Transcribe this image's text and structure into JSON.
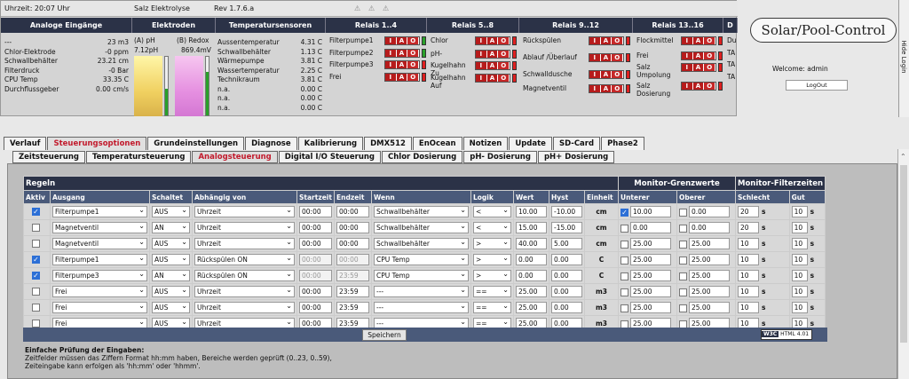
{
  "status": {
    "time": "Uhrzeit: 20:07 Uhr",
    "device": "Salz Elektrolyse",
    "rev": "Rev 1.7.6.a"
  },
  "sections": {
    "analog": "Analoge Eingänge",
    "elektroden": "Elektroden",
    "temp": "Temperatursensoren",
    "r1": "Relais 1..4",
    "r2": "Relais 5..8",
    "r3": "Relais 9..12",
    "r4": "Relais 13..16",
    "r5": "D"
  },
  "analog": [
    {
      "k": "---",
      "v": "23 m3"
    },
    {
      "k": "Chlor-Elektrode",
      "v": "-0 ppm"
    },
    {
      "k": "Schwallbehälter",
      "v": "23.21 cm"
    },
    {
      "k": "Filterdruck",
      "v": "-0 Bar"
    },
    {
      "k": "CPU Temp",
      "v": "33.35 C"
    },
    {
      "k": "Durchflussgeber",
      "v": "0.00 cm/s"
    }
  ],
  "elektroden": {
    "ph_label": "(A) pH",
    "ph_value": "7.12pH",
    "redox_label": "(B) Redox",
    "redox_value": "869.4mV",
    "ph_level": 0.45,
    "redox_level": 0.75
  },
  "temps": [
    {
      "k": "Aussentemperatur",
      "v": "4.31 C"
    },
    {
      "k": "Schwallbehälter",
      "v": "1.13 C"
    },
    {
      "k": "Wärmepumpe",
      "v": "3.81 C"
    },
    {
      "k": "Wassertemperatur",
      "v": "2.25 C"
    },
    {
      "k": "Technikraum",
      "v": "3.81 C"
    },
    {
      "k": "n.a.",
      "v": "0.00 C"
    },
    {
      "k": "n.a.",
      "v": "0.00 C"
    },
    {
      "k": "n.a.",
      "v": "0.00 C"
    }
  ],
  "relais1": [
    "Filterpumpe1",
    "Filterpumpe2",
    "Filterpumpe3",
    "Frei"
  ],
  "relais2": [
    "Chlor",
    "pH-",
    "Kugelhahn Zu",
    "Kugelhahn Auf"
  ],
  "relais3": [
    "Rückspülen",
    "Ablauf /Überlauf",
    "Schwalldusche",
    "Magnetventil"
  ],
  "relais4": [
    "Flockmittel",
    "Frei",
    "Salz Umpolung",
    "Salz Dosierung"
  ],
  "relais5": [
    "Du",
    "TA",
    "TA",
    "TA"
  ],
  "iao": {
    "i": "I",
    "a": "A",
    "o": "O"
  },
  "logo": "Solar/Pool-Control",
  "welcome": "Welcome:  admin",
  "logout": "LogOut",
  "hidelogin": "Hide Login",
  "tabs": [
    "Verlauf",
    "Steuerungsoptionen",
    "Grundeinstellungen",
    "Diagnose",
    "Kalibrierung",
    "DMX512",
    "EnOcean",
    "Notizen",
    "Update",
    "SD-Card",
    "Phase2"
  ],
  "subtabs": [
    "Zeitsteuerung",
    "Temperatursteuerung",
    "Analogsteuerung",
    "Digital I/O Steuerung",
    "Chlor Dosierung",
    "pH- Dosierung",
    "pH+ Dosierung"
  ],
  "grid": {
    "title": "Regeln",
    "monitor": "Monitor-Grenzwerte",
    "filterzeit": "Monitor-Filterzeiten",
    "cols": [
      "Aktiv",
      "Ausgang",
      "Schaltet",
      "Abhängig von",
      "Startzeit",
      "Endzeit",
      "Wenn",
      "Logik",
      "Wert",
      "Hyst",
      "Einheit",
      "Unterer",
      "Oberer",
      "Schlecht",
      "Gut"
    ],
    "rows": [
      {
        "aktiv": true,
        "ausgang": "Filterpumpe1",
        "schaltet": "AUS",
        "abh": "Uhrzeit",
        "start": "00:00",
        "end": "00:00",
        "wenn": "Schwallbehälter",
        "logik": "<",
        "wert": "10.00",
        "hyst": "-10.00",
        "einheit": "cm",
        "uc": true,
        "u": "10.00",
        "oc": false,
        "o": "0.00",
        "s": "20",
        "g": "10"
      },
      {
        "aktiv": false,
        "ausgang": "Magnetventil",
        "schaltet": "AN",
        "abh": "Uhrzeit",
        "start": "00:00",
        "end": "00:00",
        "wenn": "Schwallbehälter",
        "logik": "<",
        "wert": "15.00",
        "hyst": "-15.00",
        "einheit": "cm",
        "uc": false,
        "u": "0.00",
        "oc": false,
        "o": "0.00",
        "s": "20",
        "g": "10"
      },
      {
        "aktiv": false,
        "ausgang": "Magnetventil",
        "schaltet": "AUS",
        "abh": "Uhrzeit",
        "start": "00:00",
        "end": "00:00",
        "wenn": "Schwallbehälter",
        "logik": ">",
        "wert": "40.00",
        "hyst": "5.00",
        "einheit": "cm",
        "uc": false,
        "u": "25.00",
        "oc": false,
        "o": "25.00",
        "s": "10",
        "g": "10"
      },
      {
        "aktiv": true,
        "ausgang": "Filterpumpe1",
        "schaltet": "AUS",
        "abh": "Rückspülen ON",
        "start": "00:00",
        "end": "00:00",
        "wenn": "CPU Temp",
        "logik": ">",
        "wert": "0.00",
        "hyst": "0.00",
        "einheit": "C",
        "uc": false,
        "u": "25.00",
        "oc": false,
        "o": "25.00",
        "s": "10",
        "g": "10"
      },
      {
        "aktiv": true,
        "ausgang": "Filterpumpe3",
        "schaltet": "AN",
        "abh": "Rückspülen ON",
        "start": "00:00",
        "end": "23:59",
        "wenn": "CPU Temp",
        "logik": ">",
        "wert": "0.00",
        "hyst": "0.00",
        "einheit": "C",
        "uc": false,
        "u": "25.00",
        "oc": false,
        "o": "25.00",
        "s": "10",
        "g": "10"
      },
      {
        "aktiv": false,
        "ausgang": "Frei",
        "schaltet": "AUS",
        "abh": "Uhrzeit",
        "start": "00:00",
        "end": "23:59",
        "wenn": "---",
        "logik": "==",
        "wert": "25.00",
        "hyst": "0.00",
        "einheit": "m3",
        "uc": false,
        "u": "25.00",
        "oc": false,
        "o": "25.00",
        "s": "10",
        "g": "10"
      },
      {
        "aktiv": false,
        "ausgang": "Frei",
        "schaltet": "AUS",
        "abh": "Uhrzeit",
        "start": "00:00",
        "end": "23:59",
        "wenn": "---",
        "logik": "==",
        "wert": "25.00",
        "hyst": "0.00",
        "einheit": "m3",
        "uc": false,
        "u": "25.00",
        "oc": false,
        "o": "25.00",
        "s": "10",
        "g": "10"
      },
      {
        "aktiv": false,
        "ausgang": "Frei",
        "schaltet": "AUS",
        "abh": "Uhrzeit",
        "start": "00:00",
        "end": "23:59",
        "wenn": "---",
        "logik": "==",
        "wert": "25.00",
        "hyst": "0.00",
        "einheit": "m3",
        "uc": false,
        "u": "25.00",
        "oc": false,
        "o": "25.00",
        "s": "10",
        "g": "10"
      }
    ],
    "sec": "s"
  },
  "save": "Speichern",
  "valid": "HTML 4.01",
  "help": {
    "title": "Einfache Prüfung der Eingaben:",
    "l1": "Zeitfelder müssen das Ziffern Format hh:mm haben, Bereiche werden geprüft (0..23, 0..59),",
    "l2": "Zeiteingabe kann erfolgen als 'hh:mm' oder 'hhmm'."
  }
}
